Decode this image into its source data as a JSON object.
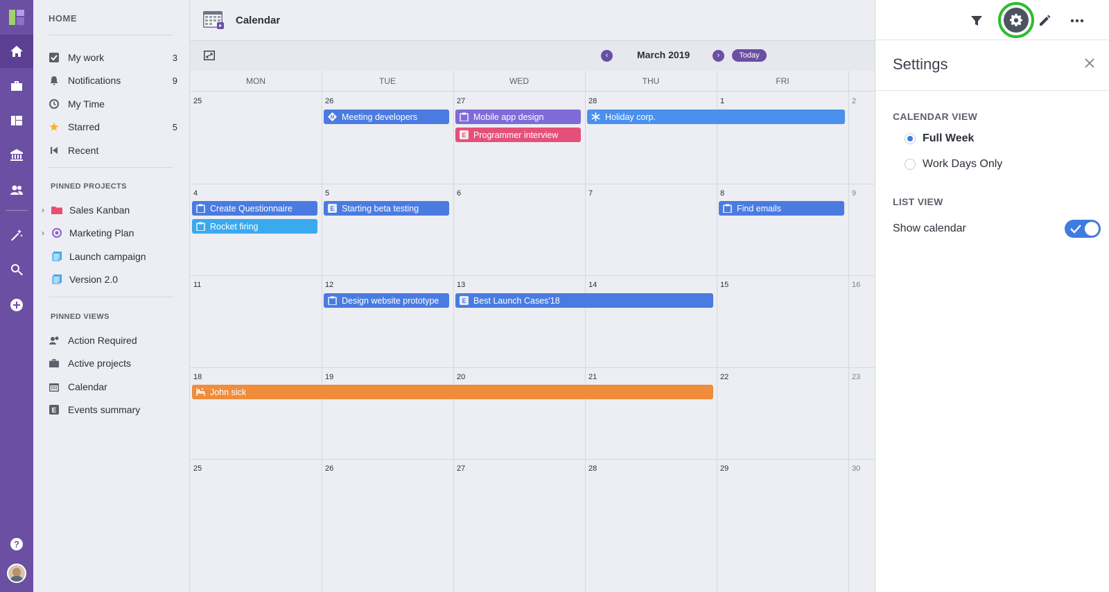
{
  "rail": {
    "items": [
      "home-icon",
      "briefcase-icon",
      "board-icon",
      "bank-icon",
      "people-icon",
      "magic-wand-icon",
      "search-icon",
      "add-icon",
      "help-icon"
    ]
  },
  "sidebar": {
    "home_heading": "HOME",
    "items": [
      {
        "label": "My work",
        "count": "3"
      },
      {
        "label": "Notifications",
        "count": "9"
      },
      {
        "label": "My Time",
        "count": ""
      },
      {
        "label": "Starred",
        "count": "5"
      },
      {
        "label": "Recent",
        "count": ""
      }
    ],
    "pinned_projects_title": "PINNED PROJECTS",
    "projects": [
      {
        "label": "Sales Kanban",
        "color": "#e8506f"
      },
      {
        "label": "Marketing Plan",
        "color": "#8a63c8"
      },
      {
        "label": "Launch campaign",
        "color": "#3aa0e8"
      },
      {
        "label": "Version 2.0",
        "color": "#3aa0e8"
      }
    ],
    "pinned_views_title": "PINNED VIEWS",
    "views": [
      {
        "label": "Action Required"
      },
      {
        "label": "Active projects"
      },
      {
        "label": "Calendar"
      },
      {
        "label": "Events summary"
      }
    ]
  },
  "header": {
    "title": "Calendar"
  },
  "toolbar": {
    "month": "March 2019",
    "today_label": "Today"
  },
  "calendar": {
    "weekdays": [
      "MON",
      "TUE",
      "WED",
      "THU",
      "FRI"
    ],
    "weeks": [
      [
        "25",
        "26",
        "27",
        "28",
        "1",
        "2"
      ],
      [
        "4",
        "5",
        "6",
        "7",
        "8",
        "9"
      ],
      [
        "11",
        "12",
        "13",
        "14",
        "15",
        "16"
      ],
      [
        "18",
        "19",
        "20",
        "21",
        "22",
        "23"
      ],
      [
        "25",
        "26",
        "27",
        "28",
        "29",
        "30"
      ]
    ],
    "events": [
      {
        "label": "Meeting developers",
        "color": "#4a7be0",
        "icon": "milestone-icon"
      },
      {
        "label": "Mobile app design",
        "color": "#7f6bd8",
        "icon": "clipboard-icon"
      },
      {
        "label": "Programmer interview",
        "color": "#e4507a",
        "icon": "event-icon"
      },
      {
        "label": "Holiday corp.",
        "color": "#4a90ec",
        "icon": "snowflake-icon"
      },
      {
        "label": "Create Questionnaire",
        "color": "#4a7be0",
        "icon": "clipboard-icon"
      },
      {
        "label": "Rocket firing",
        "color": "#3aa9ee",
        "icon": "clipboard-icon"
      },
      {
        "label": "Starting beta testing",
        "color": "#4a7be0",
        "icon": "event-icon"
      },
      {
        "label": "Find emails",
        "color": "#4a7be0",
        "icon": "clipboard-icon"
      },
      {
        "label": "Design website prototype",
        "color": "#4a7be0",
        "icon": "clipboard-icon"
      },
      {
        "label": "Best Launch Cases'18",
        "color": "#4a7be0",
        "icon": "event-icon"
      },
      {
        "label": "John sick",
        "color": "#ef8d3c",
        "icon": "sick-leave-icon"
      }
    ]
  },
  "settings": {
    "title": "Settings",
    "calendar_view_title": "CALENDAR VIEW",
    "options": [
      {
        "label": "Full Week",
        "selected": true
      },
      {
        "label": "Work Days Only",
        "selected": false
      }
    ],
    "list_view_title": "LIST VIEW",
    "show_calendar_label": "Show calendar",
    "show_calendar_on": true
  },
  "colors": {
    "accent": "#6a4fa3",
    "highlight_ring": "#2bbd2b",
    "toggle": "#3f7be0"
  }
}
